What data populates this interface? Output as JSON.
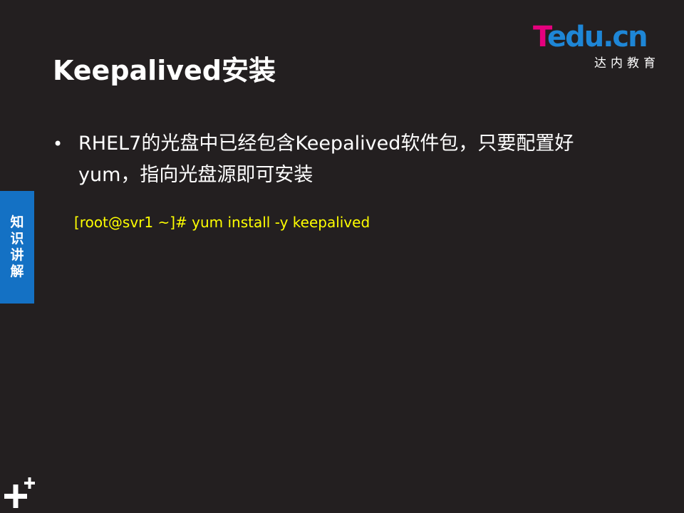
{
  "slide": {
    "title": "Keepalived安装",
    "logo": {
      "brand_t": "T",
      "brand_rest": "edu.cn",
      "subtitle": "达内教育"
    },
    "bullets": [
      {
        "symbol": "•",
        "text": "RHEL7的光盘中已经包含Keepalived软件包，只要配置好yum，指向光盘源即可安装"
      }
    ],
    "code": "[root@svr1 ~]# yum install -y keepalived",
    "side_tab": [
      "知",
      "识",
      "讲",
      "解"
    ],
    "colors": {
      "background": "#231f20",
      "code": "#ffff00",
      "tab": "#1471c4",
      "logo_magenta": "#e5007e",
      "logo_blue": "#1e86d6"
    }
  }
}
